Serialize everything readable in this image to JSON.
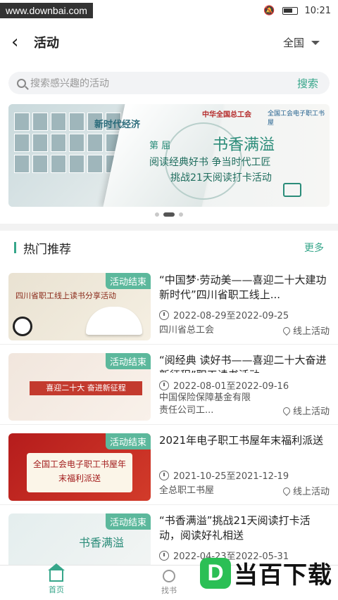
{
  "status_bar": {
    "watermark": "www.downbai.com",
    "time": "10:21"
  },
  "header": {
    "title": "活动",
    "region": "全国"
  },
  "search": {
    "placeholder": "搜索感兴趣的活动",
    "button": "搜索"
  },
  "banner": {
    "new_era": "新时代经济",
    "logo_left": "中华全国总工会",
    "logo_right": "全国工会电子职工书屋",
    "edition": "第 届",
    "headline": "书香满溢",
    "line1": "阅读经典好书  争当时代工匠",
    "line2": "挑战21天阅读打卡活动",
    "page_count": 3,
    "active_page": 2
  },
  "section": {
    "title": "热门推荐",
    "more": "更多"
  },
  "activities": [
    {
      "badge": "活动结束",
      "title": "“中国梦·劳动美——喜迎二十大建功新时代”四川省职工线上...",
      "date": "2022-08-29至2022-09-25",
      "org": "四川省总工会",
      "location": "线上活动",
      "thumb_text": "四川省职工线上读书分享活动"
    },
    {
      "badge": "活动结束",
      "title": "“阅经典 读好书——喜迎二十大奋进新征程”职工读书活动",
      "date": "2022-08-01至2022-09-16",
      "org": "中国保险保障基金有限责任公司工...",
      "location": "线上活动",
      "thumb_text": "喜迎二十大 奋进新征程"
    },
    {
      "badge": "活动结束",
      "title": "2021年电子职工书屋年末福利派送",
      "date": "2021-10-25至2021-12-19",
      "org": "全总职工书屋",
      "location": "线上活动",
      "thumb_text": "全国工会电子职工书屋年末福利派送"
    },
    {
      "badge": "活动结束",
      "title": "“书香满溢”挑战21天阅读打卡活动，阅读好礼相送",
      "date": "2022-04-23至2022-05-31",
      "org": "",
      "location": "",
      "thumb_text": "书香满溢"
    }
  ],
  "tabbar": {
    "home": "首页",
    "find": "找书"
  },
  "brand_watermark": {
    "logo": "D",
    "text": "当百下载"
  }
}
